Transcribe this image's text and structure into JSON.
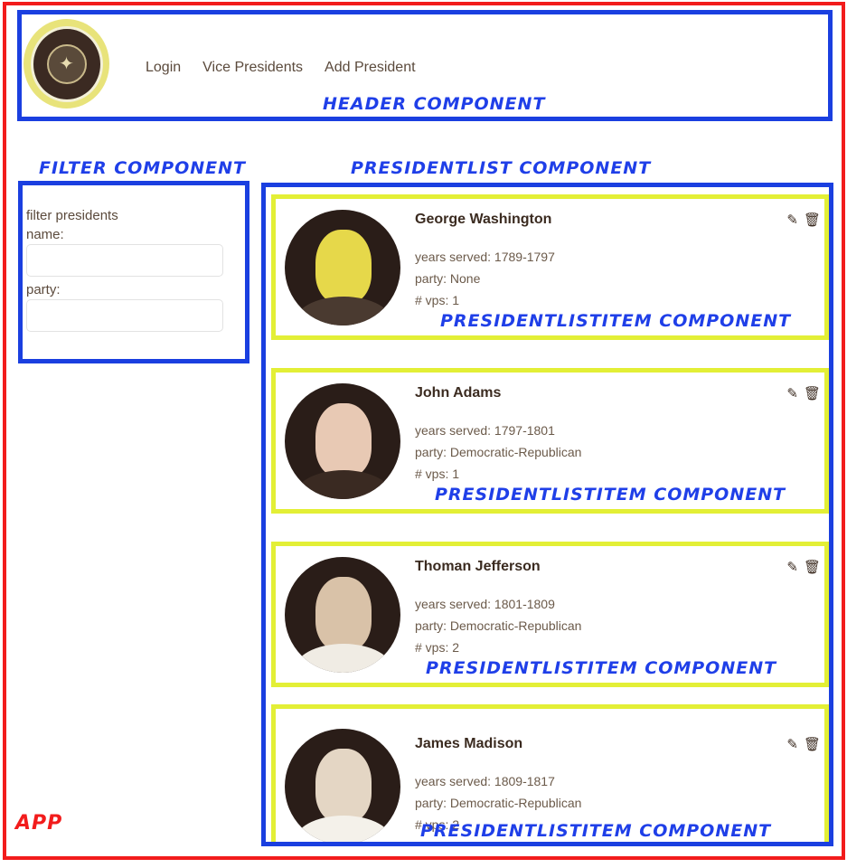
{
  "header": {
    "seal_icon": "presidential-seal",
    "nav": [
      "Login",
      "Vice Presidents",
      "Add President"
    ]
  },
  "captions": {
    "header": "HEADER COMPONENT",
    "filter": "FILTER COMPONENT",
    "plist": "PRESIDENTLIST COMPONENT",
    "item": "PRESIDENTLISTITEM COMPONENT",
    "app": "APP"
  },
  "filter": {
    "title": "filter presidents",
    "name_label": "name:",
    "party_label": "party:",
    "name_value": "",
    "party_value": ""
  },
  "presidents": [
    {
      "name": "George Washington",
      "years": "years served: 1789-1797",
      "party": "party: None",
      "vps": "# vps: 1"
    },
    {
      "name": "John Adams",
      "years": "years served: 1797-1801",
      "party": "party: Democratic-Republican",
      "vps": "# vps: 1"
    },
    {
      "name": "Thoman Jefferson",
      "years": "years served: 1801-1809",
      "party": "party: Democratic-Republican",
      "vps": "# vps: 2"
    },
    {
      "name": "James Madison",
      "years": "years served: 1809-1817",
      "party": "party: Democratic-Republican",
      "vps": "# vps: 2"
    }
  ],
  "colors": {
    "app_border": "#f21c1c",
    "component_border": "#1a3fe0",
    "item_border": "#e3ef36",
    "caption": "#1f3fe8"
  }
}
